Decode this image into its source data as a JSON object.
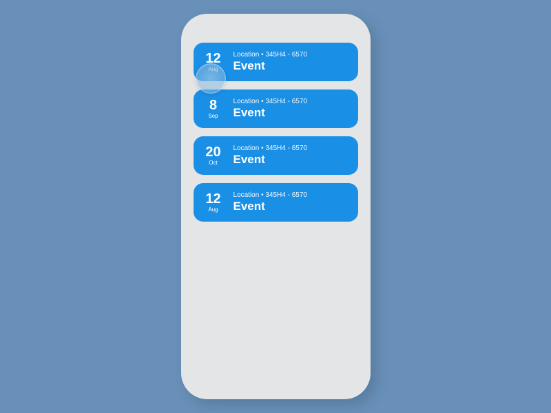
{
  "colors": {
    "background": "#6890b9",
    "phone_frame": "#e3e5e6",
    "card": "#1a8fe6"
  },
  "events": [
    {
      "day": "12",
      "month": "Aug",
      "location": "Location • 345H4 - 6570",
      "title": "Event",
      "touched": true
    },
    {
      "day": "8",
      "month": "Sep",
      "location": "Location • 345H4 - 6570",
      "title": "Event",
      "touched": false
    },
    {
      "day": "20",
      "month": "Oct",
      "location": "Location • 345H4 - 6570",
      "title": "Event",
      "touched": false
    },
    {
      "day": "12",
      "month": "Aug",
      "location": "Location • 345H4 - 6570",
      "title": "Event",
      "touched": false
    }
  ]
}
